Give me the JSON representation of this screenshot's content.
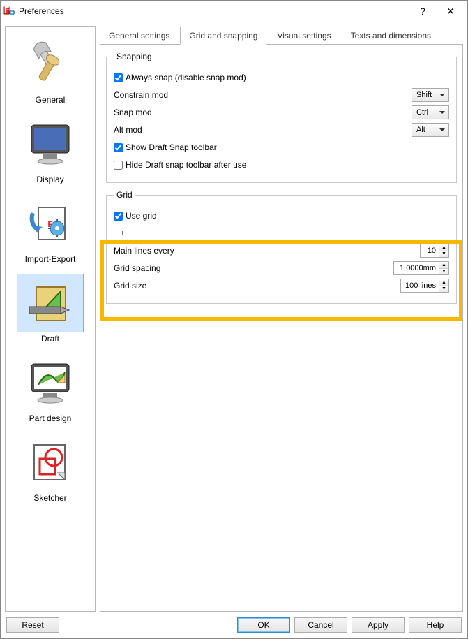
{
  "window": {
    "title": "Preferences",
    "help": "?",
    "close": "×"
  },
  "sidebar": [
    {
      "id": "general",
      "label": "General"
    },
    {
      "id": "display",
      "label": "Display"
    },
    {
      "id": "import-export",
      "label": "Import-Export"
    },
    {
      "id": "draft",
      "label": "Draft",
      "selected": true
    },
    {
      "id": "part-design",
      "label": "Part design"
    },
    {
      "id": "sketcher",
      "label": "Sketcher"
    }
  ],
  "tabs": [
    {
      "id": "general",
      "label": "General settings"
    },
    {
      "id": "grid",
      "label": "Grid and snapping",
      "active": true
    },
    {
      "id": "visual",
      "label": "Visual settings"
    },
    {
      "id": "texts",
      "label": "Texts and dimensions"
    }
  ],
  "snapping": {
    "legend": "Snapping",
    "always_snap": {
      "label": "Always snap (disable snap mod)",
      "checked": true
    },
    "constrain_mod": {
      "label": "Constrain mod",
      "value": "Shift"
    },
    "snap_mod": {
      "label": "Snap mod",
      "value": "Ctrl"
    },
    "alt_mod": {
      "label": "Alt mod",
      "value": "Alt"
    },
    "show_toolbar": {
      "label": "Show Draft Snap toolbar",
      "checked": true
    },
    "hide_after_use": {
      "label": "Hide Draft snap toolbar after use",
      "checked": false
    }
  },
  "grid": {
    "legend": "Grid",
    "use_grid": {
      "label": "Use grid",
      "checked": true
    },
    "main_lines": {
      "label": "Main lines every",
      "value": "10"
    },
    "spacing": {
      "label": "Grid spacing",
      "value": "1.0000mm"
    },
    "size": {
      "label": "Grid size",
      "value": "100 lines"
    }
  },
  "footer": {
    "reset": "Reset",
    "ok": "OK",
    "cancel": "Cancel",
    "apply": "Apply",
    "help": "Help"
  }
}
